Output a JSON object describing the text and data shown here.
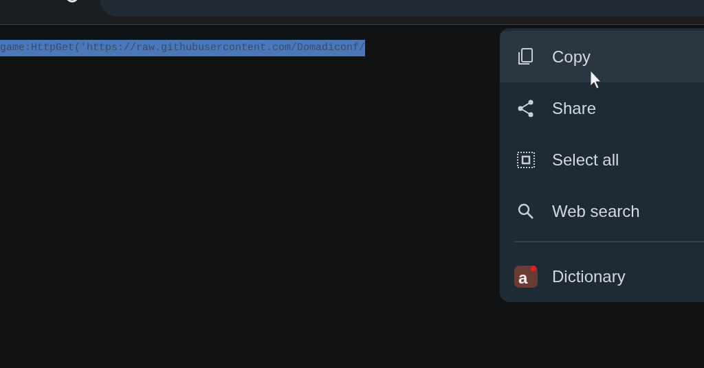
{
  "code_lines": [
    {
      "text": "game:HttpGet('https://raw.githubusercontent.com/Domadiconf/",
      "selected": true
    }
  ],
  "context_menu": {
    "items": [
      {
        "kind": "copy",
        "label": "Copy",
        "highlighted": true
      },
      {
        "kind": "share",
        "label": "Share",
        "highlighted": false
      },
      {
        "kind": "select-all",
        "label": "Select all",
        "highlighted": false
      },
      {
        "kind": "search",
        "label": "Web search",
        "highlighted": false
      },
      {
        "kind": "divider"
      },
      {
        "kind": "app",
        "label": "Dictionary",
        "icon_letter": "a",
        "highlighted": false
      }
    ]
  }
}
